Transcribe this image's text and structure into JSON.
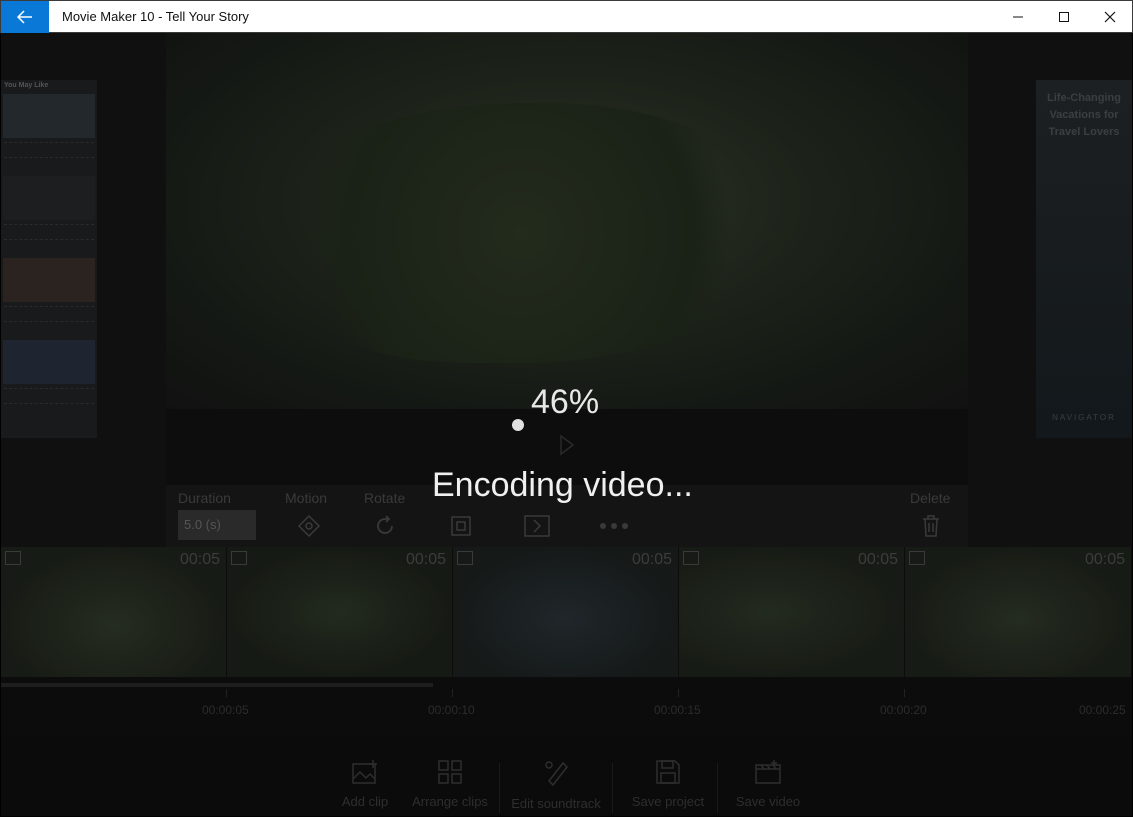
{
  "window": {
    "title": "Movie Maker 10 - Tell Your Story"
  },
  "ads": {
    "left_header": "You May Like",
    "right_headline": "Life-Changing Vacations for Travel Lovers",
    "right_brand": "NAVIGATOR"
  },
  "toolbar": {
    "duration_label": "Duration",
    "duration_value": "5.0 (s)",
    "motion_label": "Motion",
    "rotate_label": "Rotate",
    "delete_label": "Delete"
  },
  "clips": [
    {
      "time": "00:05"
    },
    {
      "time": "00:05"
    },
    {
      "time": "00:05"
    },
    {
      "time": "00:05"
    },
    {
      "time": "00:05"
    }
  ],
  "timeline": {
    "ticks": [
      "00:00:05",
      "00:00:10",
      "00:00:15",
      "00:00:20",
      "00:00:25"
    ]
  },
  "bottom_bar": {
    "add_clip": "Add clip",
    "arrange_clips": "Arrange clips",
    "edit_soundtrack": "Edit soundtrack",
    "save_project": "Save project",
    "save_video": "Save video"
  },
  "encoding": {
    "percent": "46%",
    "status": "Encoding video..."
  }
}
